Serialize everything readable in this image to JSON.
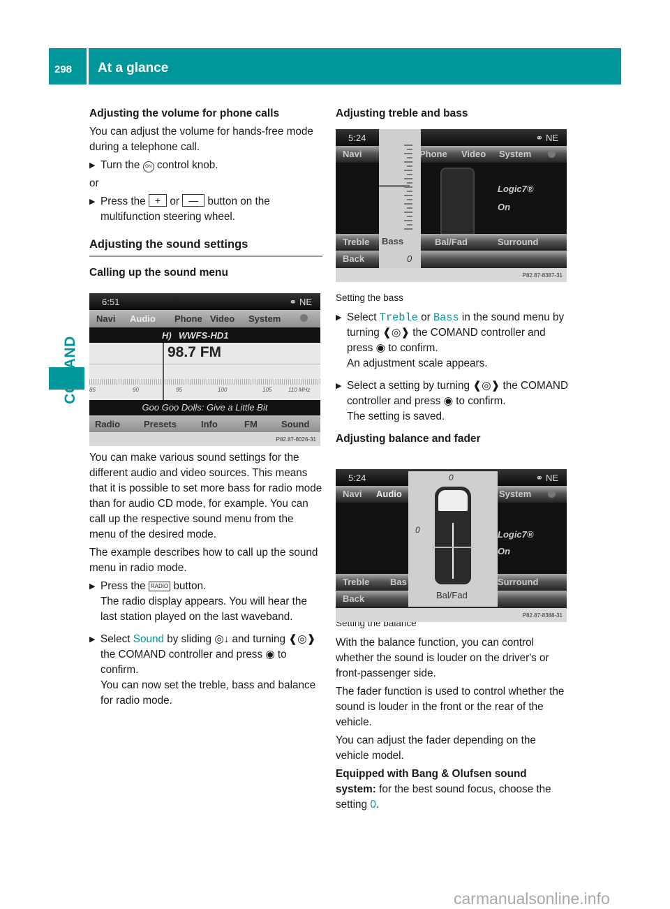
{
  "header": {
    "page_number": "298",
    "title": "At a glance"
  },
  "side_tab": {
    "label": "COMAND"
  },
  "left": {
    "sec1": {
      "heading": "Adjusting the volume for phone calls",
      "para": "You can adjust the volume for hands-free mode during a telephone call.",
      "step1_pre": "Turn the",
      "step1_icon": "ON",
      "step1_post": "control knob.",
      "or": "or",
      "step2_pre": "Press the",
      "step2_plus": "+",
      "step2_or": "or",
      "step2_minus": "—",
      "step2_post": "button on the multifunction steering wheel."
    },
    "sec2": {
      "heading": "Adjusting the sound settings",
      "subheading": "Calling up the sound menu",
      "para1": "You can make various sound settings for the different audio and video sources. This means that it is possible to set more bass for radio mode than for audio CD mode, for example. You can call up the respective sound menu from the menu of the desired mode.",
      "para2": "The example describes how to call up the sound menu in radio mode.",
      "step1_pre": "Press the",
      "step1_key": "RADIO",
      "step1_post": "button.",
      "step1_result": "The radio display appears. You will hear the last station played on the last waveband.",
      "step2_pre": "Select",
      "step2_link": "Sound",
      "step2_mid": "by sliding ◎↓ and turning ❰◎❱ the COMAND controller and press ◉ to confirm.",
      "step2_result": "You can now set the treble, bass and balance for radio mode."
    }
  },
  "screen_radio": {
    "time": "6:51",
    "compass": "NE",
    "menu": [
      "Navi",
      "Audio",
      "Phone",
      "Video",
      "System"
    ],
    "station": "WWFS-HD1",
    "frequency": "98.7 FM",
    "scale_labels": [
      "85",
      "90",
      "95",
      "100",
      "105",
      "110 MHz"
    ],
    "track": "Goo Goo Dolls: Give a Little Bit",
    "bottom_menu": [
      "Radio",
      "Presets",
      "Info",
      "FM",
      "Sound"
    ],
    "code": "P82.87-8026-31"
  },
  "right": {
    "heading1": "Adjusting treble and bass",
    "caption1": "Setting the bass",
    "step1_pre": "Select",
    "step1_link1": "Treble",
    "step1_or": "or",
    "step1_link2": "Bass",
    "step1_post": "in the sound menu by turning ❰◎❱ the COMAND controller and press ◉ to confirm.",
    "step1_result": "An adjustment scale appears.",
    "step2": "Select a setting by turning ❰◎❱ the COMAND controller and press ◉ to confirm.",
    "step2_result": "The setting is saved.",
    "heading2": "Adjusting balance and fader",
    "caption2": "Setting the balance",
    "para1": "With the balance function, you can control whether the sound is louder on the driver's or front-passenger side.",
    "para2": "The fader function is used to control whether the sound is louder in the front or the rear of the vehicle.",
    "para3": "You can adjust the fader depending on the vehicle model.",
    "para4_bold": "Equipped with Bang & Olufsen sound system:",
    "para4_text": "for the best sound focus, choose the setting",
    "para4_link": "0",
    "para4_end": "."
  },
  "screen_bass": {
    "time": "5:24",
    "compass": "NE",
    "menu": [
      "Navi",
      "Phone",
      "Video",
      "System"
    ],
    "logic": "Logic7®",
    "logic_state": "On",
    "row1": [
      "Treble",
      "Bass",
      "Bal/Fad",
      "Surround"
    ],
    "row2_left": "Back",
    "bass_value": "0",
    "code": "P82.87-8387-31"
  },
  "screen_balance": {
    "time": "5:24",
    "compass": "NE",
    "menu": [
      "Navi",
      "Audio",
      "System"
    ],
    "fader_value": "0",
    "balance_value": "0",
    "logic": "Logic7®",
    "logic_state": "On",
    "row1": [
      "Treble",
      "Bas",
      "Surround"
    ],
    "row2_left": "Back",
    "panel_label": "Bal/Fad",
    "code": "P82.87-8388-31"
  },
  "watermark": "carmanualsonline.info"
}
